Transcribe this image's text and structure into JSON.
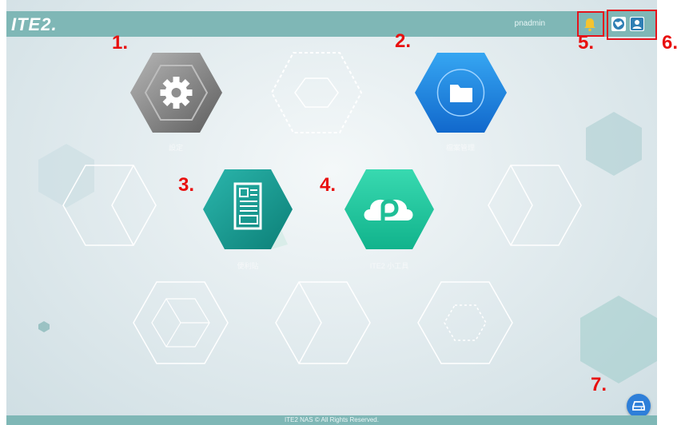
{
  "brand": {
    "logo_text": "ITE2."
  },
  "header": {
    "username": "pnadmin"
  },
  "apps": [
    {
      "label": "設定",
      "icon": "gear-icon",
      "marker": "1."
    },
    {
      "label": "檔案管理",
      "icon": "folder-icon",
      "marker": "2."
    },
    {
      "label": "便利貼",
      "icon": "note-icon",
      "marker": "3."
    },
    {
      "label": "ITE2 小工具",
      "icon": "p-cloud-icon",
      "marker": "4."
    }
  ],
  "header_icons": [
    {
      "icon": "bell-icon",
      "marker": "5."
    },
    {
      "icon": "globe-icon",
      "marker": "6."
    },
    {
      "icon": "user-icon",
      "marker": "6."
    }
  ],
  "storage": {
    "icon": "storage-drive-icon",
    "marker": "7."
  },
  "footer": {
    "copyright": "ITE2 NAS © All Rights Reserved."
  },
  "colors": {
    "topbar": "#7fb7b6",
    "marker": "#e8100f",
    "gear_hex": "#8a8a8a",
    "folder_hex": "#1f86e0",
    "note_hex": "#1fa59a",
    "p_hex": "#22c7a2"
  }
}
